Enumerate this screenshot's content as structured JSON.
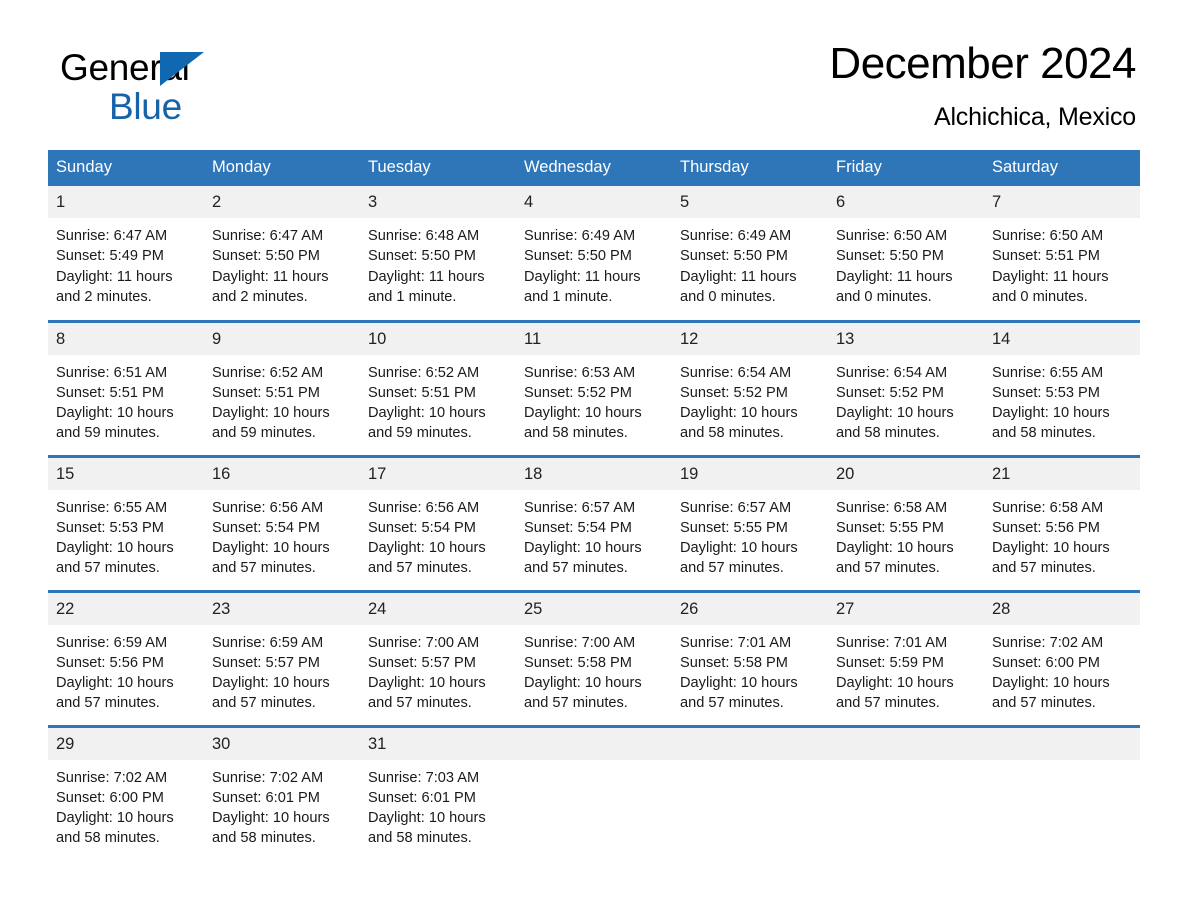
{
  "brand": {
    "logo_line1": "General",
    "logo_line2": "Blue",
    "triangle_icon": "triangle-icon",
    "black": "#000000",
    "blue": "#1464aa"
  },
  "header": {
    "title": "December 2024",
    "subtitle": "Alchichica, Mexico"
  },
  "theme": {
    "header_blue": "#2e76b8",
    "row_band": "#f1f1f1",
    "page_background": "#ffffff"
  },
  "weekdays": [
    "Sunday",
    "Monday",
    "Tuesday",
    "Wednesday",
    "Thursday",
    "Friday",
    "Saturday"
  ],
  "weeks": [
    [
      {
        "day": "1",
        "sunrise": "Sunrise: 6:47 AM",
        "sunset": "Sunset: 5:49 PM",
        "daylight_1": "Daylight: 11 hours",
        "daylight_2": "and 2 minutes."
      },
      {
        "day": "2",
        "sunrise": "Sunrise: 6:47 AM",
        "sunset": "Sunset: 5:50 PM",
        "daylight_1": "Daylight: 11 hours",
        "daylight_2": "and 2 minutes."
      },
      {
        "day": "3",
        "sunrise": "Sunrise: 6:48 AM",
        "sunset": "Sunset: 5:50 PM",
        "daylight_1": "Daylight: 11 hours",
        "daylight_2": "and 1 minute."
      },
      {
        "day": "4",
        "sunrise": "Sunrise: 6:49 AM",
        "sunset": "Sunset: 5:50 PM",
        "daylight_1": "Daylight: 11 hours",
        "daylight_2": "and 1 minute."
      },
      {
        "day": "5",
        "sunrise": "Sunrise: 6:49 AM",
        "sunset": "Sunset: 5:50 PM",
        "daylight_1": "Daylight: 11 hours",
        "daylight_2": "and 0 minutes."
      },
      {
        "day": "6",
        "sunrise": "Sunrise: 6:50 AM",
        "sunset": "Sunset: 5:50 PM",
        "daylight_1": "Daylight: 11 hours",
        "daylight_2": "and 0 minutes."
      },
      {
        "day": "7",
        "sunrise": "Sunrise: 6:50 AM",
        "sunset": "Sunset: 5:51 PM",
        "daylight_1": "Daylight: 11 hours",
        "daylight_2": "and 0 minutes."
      }
    ],
    [
      {
        "day": "8",
        "sunrise": "Sunrise: 6:51 AM",
        "sunset": "Sunset: 5:51 PM",
        "daylight_1": "Daylight: 10 hours",
        "daylight_2": "and 59 minutes."
      },
      {
        "day": "9",
        "sunrise": "Sunrise: 6:52 AM",
        "sunset": "Sunset: 5:51 PM",
        "daylight_1": "Daylight: 10 hours",
        "daylight_2": "and 59 minutes."
      },
      {
        "day": "10",
        "sunrise": "Sunrise: 6:52 AM",
        "sunset": "Sunset: 5:51 PM",
        "daylight_1": "Daylight: 10 hours",
        "daylight_2": "and 59 minutes."
      },
      {
        "day": "11",
        "sunrise": "Sunrise: 6:53 AM",
        "sunset": "Sunset: 5:52 PM",
        "daylight_1": "Daylight: 10 hours",
        "daylight_2": "and 58 minutes."
      },
      {
        "day": "12",
        "sunrise": "Sunrise: 6:54 AM",
        "sunset": "Sunset: 5:52 PM",
        "daylight_1": "Daylight: 10 hours",
        "daylight_2": "and 58 minutes."
      },
      {
        "day": "13",
        "sunrise": "Sunrise: 6:54 AM",
        "sunset": "Sunset: 5:52 PM",
        "daylight_1": "Daylight: 10 hours",
        "daylight_2": "and 58 minutes."
      },
      {
        "day": "14",
        "sunrise": "Sunrise: 6:55 AM",
        "sunset": "Sunset: 5:53 PM",
        "daylight_1": "Daylight: 10 hours",
        "daylight_2": "and 58 minutes."
      }
    ],
    [
      {
        "day": "15",
        "sunrise": "Sunrise: 6:55 AM",
        "sunset": "Sunset: 5:53 PM",
        "daylight_1": "Daylight: 10 hours",
        "daylight_2": "and 57 minutes."
      },
      {
        "day": "16",
        "sunrise": "Sunrise: 6:56 AM",
        "sunset": "Sunset: 5:54 PM",
        "daylight_1": "Daylight: 10 hours",
        "daylight_2": "and 57 minutes."
      },
      {
        "day": "17",
        "sunrise": "Sunrise: 6:56 AM",
        "sunset": "Sunset: 5:54 PM",
        "daylight_1": "Daylight: 10 hours",
        "daylight_2": "and 57 minutes."
      },
      {
        "day": "18",
        "sunrise": "Sunrise: 6:57 AM",
        "sunset": "Sunset: 5:54 PM",
        "daylight_1": "Daylight: 10 hours",
        "daylight_2": "and 57 minutes."
      },
      {
        "day": "19",
        "sunrise": "Sunrise: 6:57 AM",
        "sunset": "Sunset: 5:55 PM",
        "daylight_1": "Daylight: 10 hours",
        "daylight_2": "and 57 minutes."
      },
      {
        "day": "20",
        "sunrise": "Sunrise: 6:58 AM",
        "sunset": "Sunset: 5:55 PM",
        "daylight_1": "Daylight: 10 hours",
        "daylight_2": "and 57 minutes."
      },
      {
        "day": "21",
        "sunrise": "Sunrise: 6:58 AM",
        "sunset": "Sunset: 5:56 PM",
        "daylight_1": "Daylight: 10 hours",
        "daylight_2": "and 57 minutes."
      }
    ],
    [
      {
        "day": "22",
        "sunrise": "Sunrise: 6:59 AM",
        "sunset": "Sunset: 5:56 PM",
        "daylight_1": "Daylight: 10 hours",
        "daylight_2": "and 57 minutes."
      },
      {
        "day": "23",
        "sunrise": "Sunrise: 6:59 AM",
        "sunset": "Sunset: 5:57 PM",
        "daylight_1": "Daylight: 10 hours",
        "daylight_2": "and 57 minutes."
      },
      {
        "day": "24",
        "sunrise": "Sunrise: 7:00 AM",
        "sunset": "Sunset: 5:57 PM",
        "daylight_1": "Daylight: 10 hours",
        "daylight_2": "and 57 minutes."
      },
      {
        "day": "25",
        "sunrise": "Sunrise: 7:00 AM",
        "sunset": "Sunset: 5:58 PM",
        "daylight_1": "Daylight: 10 hours",
        "daylight_2": "and 57 minutes."
      },
      {
        "day": "26",
        "sunrise": "Sunrise: 7:01 AM",
        "sunset": "Sunset: 5:58 PM",
        "daylight_1": "Daylight: 10 hours",
        "daylight_2": "and 57 minutes."
      },
      {
        "day": "27",
        "sunrise": "Sunrise: 7:01 AM",
        "sunset": "Sunset: 5:59 PM",
        "daylight_1": "Daylight: 10 hours",
        "daylight_2": "and 57 minutes."
      },
      {
        "day": "28",
        "sunrise": "Sunrise: 7:02 AM",
        "sunset": "Sunset: 6:00 PM",
        "daylight_1": "Daylight: 10 hours",
        "daylight_2": "and 57 minutes."
      }
    ],
    [
      {
        "day": "29",
        "sunrise": "Sunrise: 7:02 AM",
        "sunset": "Sunset: 6:00 PM",
        "daylight_1": "Daylight: 10 hours",
        "daylight_2": "and 58 minutes."
      },
      {
        "day": "30",
        "sunrise": "Sunrise: 7:02 AM",
        "sunset": "Sunset: 6:01 PM",
        "daylight_1": "Daylight: 10 hours",
        "daylight_2": "and 58 minutes."
      },
      {
        "day": "31",
        "sunrise": "Sunrise: 7:03 AM",
        "sunset": "Sunset: 6:01 PM",
        "daylight_1": "Daylight: 10 hours",
        "daylight_2": "and 58 minutes."
      },
      {
        "day": "",
        "sunrise": "",
        "sunset": "",
        "daylight_1": "",
        "daylight_2": ""
      },
      {
        "day": "",
        "sunrise": "",
        "sunset": "",
        "daylight_1": "",
        "daylight_2": ""
      },
      {
        "day": "",
        "sunrise": "",
        "sunset": "",
        "daylight_1": "",
        "daylight_2": ""
      },
      {
        "day": "",
        "sunrise": "",
        "sunset": "",
        "daylight_1": "",
        "daylight_2": ""
      }
    ]
  ]
}
